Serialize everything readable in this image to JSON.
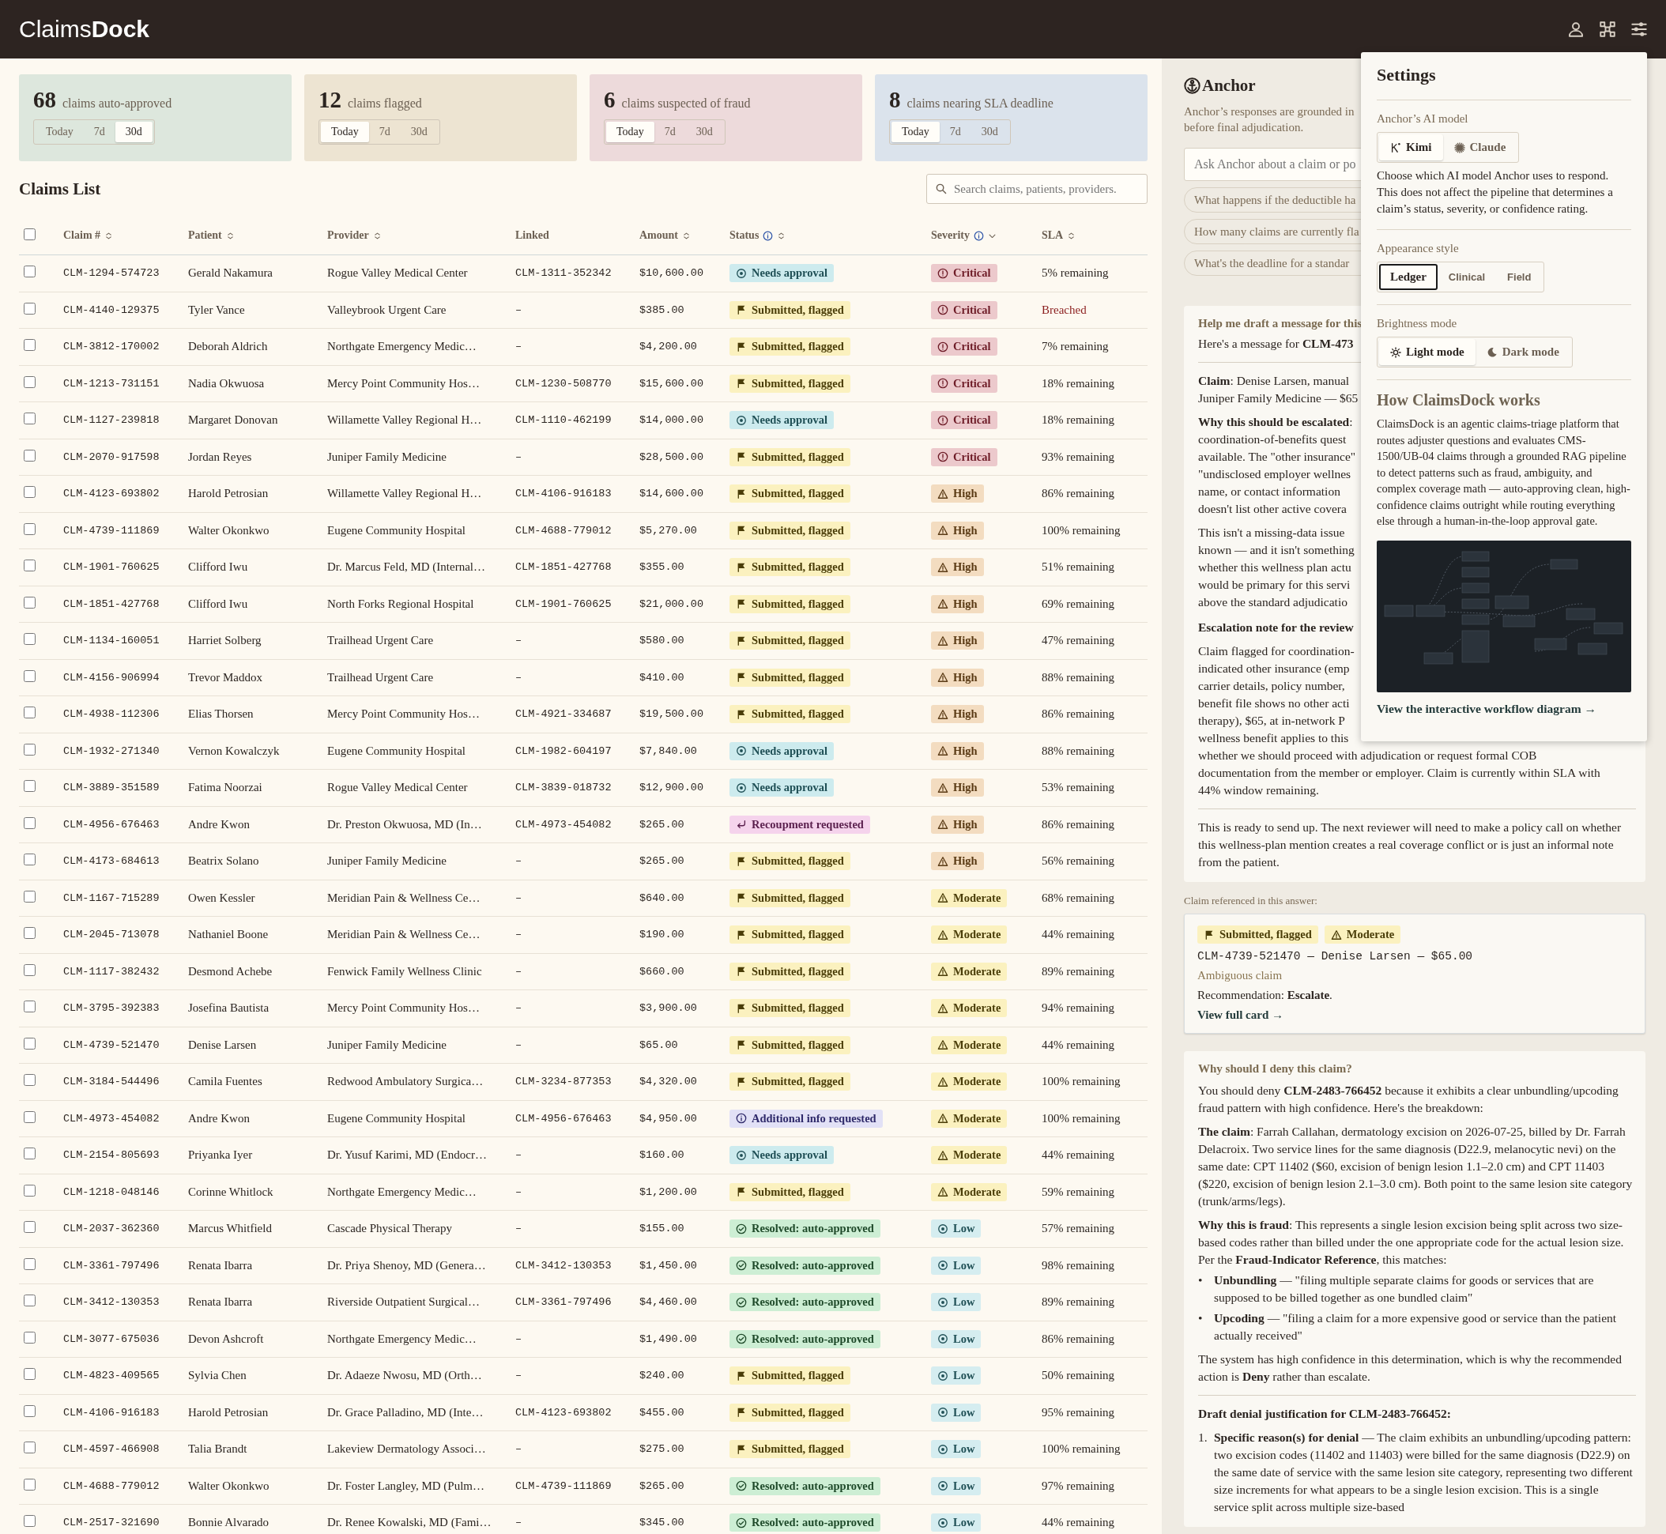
{
  "app": {
    "logo": "Claims**Dock**"
  },
  "stats": [
    {
      "count": "68",
      "label": "claims auto-approved",
      "color": "#dde7dd",
      "ranges": [
        {
          "label": "Today",
          "selected": false
        },
        {
          "label": "7d",
          "selected": false
        },
        {
          "label": "30d",
          "selected": true
        }
      ]
    },
    {
      "count": "12",
      "label": "claims flagged",
      "color": "#ede4d2",
      "ranges": [
        {
          "label": "Today",
          "selected": true
        },
        {
          "label": "7d",
          "selected": false
        },
        {
          "label": "30d",
          "selected": false
        }
      ]
    },
    {
      "count": "6",
      "label": "claims suspected of fraud",
      "color": "#eddadb",
      "ranges": [
        {
          "label": "Today",
          "selected": true
        },
        {
          "label": "7d",
          "selected": false
        },
        {
          "label": "30d",
          "selected": false
        }
      ]
    },
    {
      "count": "8",
      "label": "claims nearing SLA deadline",
      "color": "#dbe3ec",
      "ranges": [
        {
          "label": "Today",
          "selected": true
        },
        {
          "label": "7d",
          "selected": false
        },
        {
          "label": "30d",
          "selected": false
        }
      ]
    }
  ],
  "claims_list": {
    "title": "Claims List",
    "search_placeholder": "Search claims, patients, providers.",
    "select_all_checked": false,
    "columns": [
      {
        "label": "Claim #",
        "info": false,
        "kind": "sortable"
      },
      {
        "label": "Patient",
        "info": false,
        "kind": "sortable"
      },
      {
        "label": "Provider",
        "info": false,
        "kind": "sortable"
      },
      {
        "label": "Linked",
        "info": false,
        "kind": "plain"
      },
      {
        "label": "Amount",
        "info": false,
        "kind": "sortable"
      },
      {
        "label": "Status",
        "info": true,
        "kind": "sortable"
      },
      {
        "label": "Severity",
        "info": true,
        "kind": "dropdown"
      },
      {
        "label": "SLA",
        "info": false,
        "kind": "sortable"
      }
    ],
    "rows": [
      {
        "claim": "CLM-1294-574723",
        "patient": "Gerald Nakamura",
        "provider": "Rogue Valley Medical Center",
        "linked": "CLM-1311-352342",
        "amount": "$10,600.00",
        "status": {
          "kind": "approval",
          "label": "Needs approval"
        },
        "severity": {
          "kind": "critical",
          "label": "Critical"
        },
        "sla": {
          "text": "5% remaining",
          "breached": false
        },
        "checked": false
      },
      {
        "claim": "CLM-4140-129375",
        "patient": "Tyler Vance",
        "provider": "Valleybrook Urgent Care",
        "linked": "–",
        "amount": "$385.00",
        "status": {
          "kind": "flagged",
          "label": "Submitted, flagged"
        },
        "severity": {
          "kind": "critical",
          "label": "Critical"
        },
        "sla": {
          "text": "Breached",
          "breached": true
        },
        "checked": false
      },
      {
        "claim": "CLM-3812-170002",
        "patient": "Deborah Aldrich",
        "provider": "Northgate Emergency Medic…",
        "linked": "–",
        "amount": "$4,200.00",
        "status": {
          "kind": "flagged",
          "label": "Submitted, flagged"
        },
        "severity": {
          "kind": "critical",
          "label": "Critical"
        },
        "sla": {
          "text": "7% remaining",
          "breached": false
        },
        "checked": false
      },
      {
        "claim": "CLM-1213-731151",
        "patient": "Nadia Okwuosa",
        "provider": "Mercy Point Community Hos…",
        "linked": "CLM-1230-508770",
        "amount": "$15,600.00",
        "status": {
          "kind": "flagged",
          "label": "Submitted, flagged"
        },
        "severity": {
          "kind": "critical",
          "label": "Critical"
        },
        "sla": {
          "text": "18% remaining",
          "breached": false
        },
        "checked": false
      },
      {
        "claim": "CLM-1127-239818",
        "patient": "Margaret Donovan",
        "provider": "Willamette Valley Regional H…",
        "linked": "CLM-1110-462199",
        "amount": "$14,000.00",
        "status": {
          "kind": "approval",
          "label": "Needs approval"
        },
        "severity": {
          "kind": "critical",
          "label": "Critical"
        },
        "sla": {
          "text": "18% remaining",
          "breached": false
        },
        "checked": false
      },
      {
        "claim": "CLM-2070-917598",
        "patient": "Jordan Reyes",
        "provider": "Juniper Family Medicine",
        "linked": "–",
        "amount": "$28,500.00",
        "status": {
          "kind": "flagged",
          "label": "Submitted, flagged"
        },
        "severity": {
          "kind": "critical",
          "label": "Critical"
        },
        "sla": {
          "text": "93% remaining",
          "breached": false
        },
        "checked": false
      },
      {
        "claim": "CLM-4123-693802",
        "patient": "Harold Petrosian",
        "provider": "Willamette Valley Regional H…",
        "linked": "CLM-4106-916183",
        "amount": "$14,600.00",
        "status": {
          "kind": "flagged",
          "label": "Submitted, flagged"
        },
        "severity": {
          "kind": "high",
          "label": "High"
        },
        "sla": {
          "text": "86% remaining",
          "breached": false
        },
        "checked": false
      },
      {
        "claim": "CLM-4739-111869",
        "patient": "Walter Okonkwo",
        "provider": "Eugene Community Hospital",
        "linked": "CLM-4688-779012",
        "amount": "$5,270.00",
        "status": {
          "kind": "flagged",
          "label": "Submitted, flagged"
        },
        "severity": {
          "kind": "high",
          "label": "High"
        },
        "sla": {
          "text": "100% remaining",
          "breached": false
        },
        "checked": false
      },
      {
        "claim": "CLM-1901-760625",
        "patient": "Clifford Iwu",
        "provider": "Dr. Marcus Feld, MD (Internal…",
        "linked": "CLM-1851-427768",
        "amount": "$355.00",
        "status": {
          "kind": "flagged",
          "label": "Submitted, flagged"
        },
        "severity": {
          "kind": "high",
          "label": "High"
        },
        "sla": {
          "text": "51% remaining",
          "breached": false
        },
        "checked": false
      },
      {
        "claim": "CLM-1851-427768",
        "patient": "Clifford Iwu",
        "provider": "North Forks Regional Hospital",
        "linked": "CLM-1901-760625",
        "amount": "$21,000.00",
        "status": {
          "kind": "flagged",
          "label": "Submitted, flagged"
        },
        "severity": {
          "kind": "high",
          "label": "High"
        },
        "sla": {
          "text": "69% remaining",
          "breached": false
        },
        "checked": false
      },
      {
        "claim": "CLM-1134-160051",
        "patient": "Harriet Solberg",
        "provider": "Trailhead Urgent Care",
        "linked": "–",
        "amount": "$580.00",
        "status": {
          "kind": "flagged",
          "label": "Submitted, flagged"
        },
        "severity": {
          "kind": "high",
          "label": "High"
        },
        "sla": {
          "text": "47% remaining",
          "breached": false
        },
        "checked": false
      },
      {
        "claim": "CLM-4156-906994",
        "patient": "Trevor Maddox",
        "provider": "Trailhead Urgent Care",
        "linked": "–",
        "amount": "$410.00",
        "status": {
          "kind": "flagged",
          "label": "Submitted, flagged"
        },
        "severity": {
          "kind": "high",
          "label": "High"
        },
        "sla": {
          "text": "88% remaining",
          "breached": false
        },
        "checked": false
      },
      {
        "claim": "CLM-4938-112306",
        "patient": "Elias Thorsen",
        "provider": "Mercy Point Community Hos…",
        "linked": "CLM-4921-334687",
        "amount": "$19,500.00",
        "status": {
          "kind": "flagged",
          "label": "Submitted, flagged"
        },
        "severity": {
          "kind": "high",
          "label": "High"
        },
        "sla": {
          "text": "86% remaining",
          "breached": false
        },
        "checked": false
      },
      {
        "claim": "CLM-1932-271340",
        "patient": "Vernon Kowalczyk",
        "provider": "Eugene Community Hospital",
        "linked": "CLM-1982-604197",
        "amount": "$7,840.00",
        "status": {
          "kind": "approval",
          "label": "Needs approval"
        },
        "severity": {
          "kind": "high",
          "label": "High"
        },
        "sla": {
          "text": "88% remaining",
          "breached": false
        },
        "checked": false
      },
      {
        "claim": "CLM-3889-351589",
        "patient": "Fatima Noorzai",
        "provider": "Rogue Valley Medical Center",
        "linked": "CLM-3839-018732",
        "amount": "$12,900.00",
        "status": {
          "kind": "approval",
          "label": "Needs approval"
        },
        "severity": {
          "kind": "high",
          "label": "High"
        },
        "sla": {
          "text": "53% remaining",
          "breached": false
        },
        "checked": false
      },
      {
        "claim": "CLM-4956-676463",
        "patient": "Andre Kwon",
        "provider": "Dr. Preston Okwuosa, MD (In…",
        "linked": "CLM-4973-454082",
        "amount": "$265.00",
        "status": {
          "kind": "recoup",
          "label": "Recoupment requested"
        },
        "severity": {
          "kind": "high",
          "label": "High"
        },
        "sla": {
          "text": "86% remaining",
          "breached": false
        },
        "checked": false
      },
      {
        "claim": "CLM-4173-684613",
        "patient": "Beatrix Solano",
        "provider": "Juniper Family Medicine",
        "linked": "–",
        "amount": "$265.00",
        "status": {
          "kind": "flagged",
          "label": "Submitted, flagged"
        },
        "severity": {
          "kind": "high",
          "label": "High"
        },
        "sla": {
          "text": "56% remaining",
          "breached": false
        },
        "checked": false
      },
      {
        "claim": "CLM-1167-715289",
        "patient": "Owen Kessler",
        "provider": "Meridian Pain & Wellness Ce…",
        "linked": "–",
        "amount": "$640.00",
        "status": {
          "kind": "flagged",
          "label": "Submitted, flagged"
        },
        "severity": {
          "kind": "moderate",
          "label": "Moderate"
        },
        "sla": {
          "text": "68% remaining",
          "breached": false
        },
        "checked": false
      },
      {
        "claim": "CLM-2045-713078",
        "patient": "Nathaniel Boone",
        "provider": "Meridian Pain & Wellness Ce…",
        "linked": "–",
        "amount": "$190.00",
        "status": {
          "kind": "flagged",
          "label": "Submitted, flagged"
        },
        "severity": {
          "kind": "moderate",
          "label": "Moderate"
        },
        "sla": {
          "text": "44% remaining",
          "breached": false
        },
        "checked": false
      },
      {
        "claim": "CLM-1117-382432",
        "patient": "Desmond Achebe",
        "provider": "Fenwick Family Wellness Clinic",
        "linked": "–",
        "amount": "$660.00",
        "status": {
          "kind": "flagged",
          "label": "Submitted, flagged"
        },
        "severity": {
          "kind": "moderate",
          "label": "Moderate"
        },
        "sla": {
          "text": "89% remaining",
          "breached": false
        },
        "checked": false
      },
      {
        "claim": "CLM-3795-392383",
        "patient": "Josefina Bautista",
        "provider": "Mercy Point Community Hos…",
        "linked": "–",
        "amount": "$3,900.00",
        "status": {
          "kind": "flagged",
          "label": "Submitted, flagged"
        },
        "severity": {
          "kind": "moderate",
          "label": "Moderate"
        },
        "sla": {
          "text": "94% remaining",
          "breached": false
        },
        "checked": false
      },
      {
        "claim": "CLM-4739-521470",
        "patient": "Denise Larsen",
        "provider": "Juniper Family Medicine",
        "linked": "–",
        "amount": "$65.00",
        "status": {
          "kind": "flagged",
          "label": "Submitted, flagged"
        },
        "severity": {
          "kind": "moderate",
          "label": "Moderate"
        },
        "sla": {
          "text": "44% remaining",
          "breached": false
        },
        "checked": false
      },
      {
        "claim": "CLM-3184-544496",
        "patient": "Camila Fuentes",
        "provider": "Redwood Ambulatory Surgica…",
        "linked": "CLM-3234-877353",
        "amount": "$4,320.00",
        "status": {
          "kind": "flagged",
          "label": "Submitted, flagged"
        },
        "severity": {
          "kind": "moderate",
          "label": "Moderate"
        },
        "sla": {
          "text": "100% remaining",
          "breached": false
        },
        "checked": false
      },
      {
        "claim": "CLM-4973-454082",
        "patient": "Andre Kwon",
        "provider": "Eugene Community Hospital",
        "linked": "CLM-4956-676463",
        "amount": "$4,950.00",
        "status": {
          "kind": "info",
          "label": "Additional info requested"
        },
        "severity": {
          "kind": "moderate",
          "label": "Moderate"
        },
        "sla": {
          "text": "100% remaining",
          "breached": false
        },
        "checked": false
      },
      {
        "claim": "CLM-2154-805693",
        "patient": "Priyanka Iyer",
        "provider": "Dr. Yusuf Karimi, MD (Endocr…",
        "linked": "–",
        "amount": "$160.00",
        "status": {
          "kind": "approval",
          "label": "Needs approval"
        },
        "severity": {
          "kind": "moderate",
          "label": "Moderate"
        },
        "sla": {
          "text": "44% remaining",
          "breached": false
        },
        "checked": false
      },
      {
        "claim": "CLM-1218-048146",
        "patient": "Corinne Whitlock",
        "provider": "Northgate Emergency Medic…",
        "linked": "–",
        "amount": "$1,200.00",
        "status": {
          "kind": "flagged",
          "label": "Submitted, flagged"
        },
        "severity": {
          "kind": "moderate",
          "label": "Moderate"
        },
        "sla": {
          "text": "59% remaining",
          "breached": false
        },
        "checked": false
      },
      {
        "claim": "CLM-2037-362360",
        "patient": "Marcus Whitfield",
        "provider": "Cascade Physical Therapy",
        "linked": "–",
        "amount": "$155.00",
        "status": {
          "kind": "auto",
          "label": "Resolved: auto-approved"
        },
        "severity": {
          "kind": "low",
          "label": "Low"
        },
        "sla": {
          "text": "57% remaining",
          "breached": false
        },
        "checked": false
      },
      {
        "claim": "CLM-3361-797496",
        "patient": "Renata Ibarra",
        "provider": "Dr. Priya Shenoy, MD (Genera…",
        "linked": "CLM-3412-130353",
        "amount": "$1,450.00",
        "status": {
          "kind": "auto",
          "label": "Resolved: auto-approved"
        },
        "severity": {
          "kind": "low",
          "label": "Low"
        },
        "sla": {
          "text": "98% remaining",
          "breached": false
        },
        "checked": false
      },
      {
        "claim": "CLM-3412-130353",
        "patient": "Renata Ibarra",
        "provider": "Riverside Outpatient Surgical…",
        "linked": "CLM-3361-797496",
        "amount": "$4,460.00",
        "status": {
          "kind": "auto",
          "label": "Resolved: auto-approved"
        },
        "severity": {
          "kind": "low",
          "label": "Low"
        },
        "sla": {
          "text": "89% remaining",
          "breached": false
        },
        "checked": false
      },
      {
        "claim": "CLM-3077-675036",
        "patient": "Devon Ashcroft",
        "provider": "Northgate Emergency Medic…",
        "linked": "–",
        "amount": "$1,490.00",
        "status": {
          "kind": "auto",
          "label": "Resolved: auto-approved"
        },
        "severity": {
          "kind": "low",
          "label": "Low"
        },
        "sla": {
          "text": "86% remaining",
          "breached": false
        },
        "checked": false
      },
      {
        "claim": "CLM-4823-409565",
        "patient": "Sylvia Chen",
        "provider": "Dr. Adaeze Nwosu, MD (Orth…",
        "linked": "–",
        "amount": "$240.00",
        "status": {
          "kind": "flagged",
          "label": "Submitted, flagged"
        },
        "severity": {
          "kind": "low",
          "label": "Low"
        },
        "sla": {
          "text": "50% remaining",
          "breached": false
        },
        "checked": false
      },
      {
        "claim": "CLM-4106-916183",
        "patient": "Harold Petrosian",
        "provider": "Dr. Grace Palladino, MD (Inte…",
        "linked": "CLM-4123-693802",
        "amount": "$455.00",
        "status": {
          "kind": "flagged",
          "label": "Submitted, flagged"
        },
        "severity": {
          "kind": "low",
          "label": "Low"
        },
        "sla": {
          "text": "95% remaining",
          "breached": false
        },
        "checked": false
      },
      {
        "claim": "CLM-4597-466908",
        "patient": "Talia Brandt",
        "provider": "Lakeview Dermatology Associ…",
        "linked": "–",
        "amount": "$275.00",
        "status": {
          "kind": "flagged",
          "label": "Submitted, flagged"
        },
        "severity": {
          "kind": "low",
          "label": "Low"
        },
        "sla": {
          "text": "100% remaining",
          "breached": false
        },
        "checked": false
      },
      {
        "claim": "CLM-4688-779012",
        "patient": "Walter Okonkwo",
        "provider": "Dr. Foster Langley, MD (Pulm…",
        "linked": "CLM-4739-111869",
        "amount": "$265.00",
        "status": {
          "kind": "auto",
          "label": "Resolved: auto-approved"
        },
        "severity": {
          "kind": "low",
          "label": "Low"
        },
        "sla": {
          "text": "97% remaining",
          "breached": false
        },
        "checked": false
      },
      {
        "claim": "CLM-2517-321690",
        "patient": "Bonnie Alvarado",
        "provider": "Dr. Renee Kowalski, MD (Fami…",
        "linked": "–",
        "amount": "$345.00",
        "status": {
          "kind": "auto",
          "label": "Resolved: auto-approved"
        },
        "severity": {
          "kind": "low",
          "label": "Low"
        },
        "sla": {
          "text": "44% remaining",
          "breached": false
        },
        "checked": false
      }
    ]
  },
  "anchor": {
    "title": "Anchor",
    "subtitle_lines": [
      "Anchor’s responses are grounded in",
      "before final adjudication."
    ],
    "input_placeholder": "Ask Anchor about a claim or po",
    "suggestions": [
      "What happens if the deductible ha",
      "How many claims are currently fla",
      "What's the deadline for a standar"
    ],
    "messages": [
      {
        "question": "Help me draft a message for this",
        "blocks": [
          {
            "kind": "lines",
            "lines": [
              "Here's a message for **CLM-473**"
            ]
          },
          {
            "kind": "rule"
          },
          {
            "kind": "lines",
            "lines": [
              "**Claim**: Denise Larsen, manual",
              "Juniper Family Medicine — $65"
            ]
          },
          {
            "kind": "lines",
            "lines": [
              "**Why this should be escalated**:",
              "coordination-of-benefits quest",
              "available. The \"other insurance\"",
              "\"undisclosed employer wellnes",
              "name, or contact information",
              "doesn't list other active covera"
            ]
          },
          {
            "kind": "lines",
            "lines": [
              "This isn't a missing-data issue",
              "known — and it isn't something",
              "whether this wellness plan actu",
              "would be primary for this servi",
              "above the standard adjudicatio"
            ]
          },
          {
            "kind": "heading",
            "text": "Escalation note for the review"
          },
          {
            "kind": "lines",
            "lines": [
              "Claim flagged for coordination-",
              "indicated other insurance (emp",
              "carrier details, policy number,",
              "benefit file shows no other acti",
              "therapy), $65, at in-network P",
              "wellness benefit applies to this",
              "whether we should proceed with adjudication or request formal COB",
              "documentation from the member or employer. Claim is currently within SLA with",
              "44% window remaining."
            ]
          },
          {
            "kind": "rule"
          },
          {
            "kind": "para",
            "text": "This is ready to send up. The next reviewer will need to make a policy call on whether this wellness-plan mention creates a real coverage conflict or is just an informal note from the patient."
          }
        ]
      },
      {
        "kind": "reference",
        "label": "Claim referenced in this answer:",
        "status": {
          "kind": "flagged",
          "label": "Submitted, flagged"
        },
        "severity": {
          "kind": "moderate",
          "label": "Moderate"
        },
        "summary": "CLM-4739-521470 — Denise Larsen — $65.00",
        "category": "Ambiguous claim",
        "recommendation": "Recommendation: **Escalate**.",
        "link": "View full card →"
      },
      {
        "question": "Why should I deny this claim?",
        "blocks": [
          {
            "kind": "para",
            "text": "You should deny **CLM-2483-766452** because it exhibits a clear unbundling/upcoding fraud pattern with high confidence. Here's the breakdown:"
          },
          {
            "kind": "para",
            "text": "**The claim**: Farrah Callahan, dermatology excision on 2026-07-25, billed by Dr. Farrah Delacroix. Two service lines for the same diagnosis (D22.9, melanocytic nevi) on the same date: CPT 11402 ($60, excision of benign lesion 1.1–2.0 cm) and CPT 11403 ($220, excision of benign lesion 2.1–3.0 cm). Both point to the same lesion site category (trunk/arms/legs)."
          },
          {
            "kind": "para",
            "text": "**Why this is fraud**: This represents a single lesion excision being split across two size-based codes rather than billed under the one appropriate code for the actual lesion size. Per the **Fraud-Indicator Reference**, this matches:"
          },
          {
            "kind": "list",
            "items": [
              {
                "marker": "•",
                "text": "**Unbundling** — \"filing multiple separate claims for goods or services that are supposed to be billed together as one bundled claim\""
              },
              {
                "marker": "•",
                "text": "**Upcoding** — \"filing a claim for a more expensive good or service than the patient actually received\""
              }
            ]
          },
          {
            "kind": "para",
            "text": "The system has high confidence in this determination, which is why the recommended action is **Deny** rather than escalate."
          },
          {
            "kind": "rule"
          },
          {
            "kind": "heading",
            "text": "Draft denial justification for CLM-2483-766452:"
          },
          {
            "kind": "list",
            "items": [
              {
                "marker": "1.",
                "text": "**Specific reason(s) for denial** — The claim exhibits an unbundling/upcoding pattern: two excision codes (11402 and 11403) were billed for the same diagnosis (D22.9) on the same date of service with the same lesion site category, representing two different size increments for what appears to be a single lesion excision. This is a single service split across multiple size-based"
              }
            ]
          }
        ]
      }
    ]
  },
  "settings": {
    "title": "Settings",
    "sections": [
      {
        "kind": "choice",
        "label": "Anchor’s AI model",
        "options": [
          {
            "label": "Kimi",
            "selected": true
          },
          {
            "label": "Claude",
            "selected": false
          }
        ],
        "description": "Choose which AI model Anchor uses to respond. This does not affect the pipeline that determines a claim’s status, severity, or confidence rating."
      },
      {
        "kind": "choice",
        "label": "Appearance style",
        "options": [
          {
            "label": "Ledger",
            "selected": true
          },
          {
            "label": "Clinical",
            "selected": false
          },
          {
            "label": "Field",
            "selected": false
          }
        ]
      },
      {
        "kind": "choice",
        "label": "Brightness mode",
        "options": [
          {
            "label": "Light mode",
            "selected": true
          },
          {
            "label": "Dark mode",
            "selected": false
          }
        ]
      },
      {
        "kind": "about",
        "heading": "How ClaimsDock works",
        "text": "ClaimsDock is an agentic claims-triage platform that routes adjuster questions and evaluates CMS-1500/UB-04 claims through a grounded RAG pipeline to detect patterns such as fraud, ambiguity, and complex coverage math — auto-approving clean, high-confidence claims outright while routing everything else through a human-in-the-loop approval gate.",
        "link": "View the interactive workflow diagram →"
      }
    ]
  }
}
